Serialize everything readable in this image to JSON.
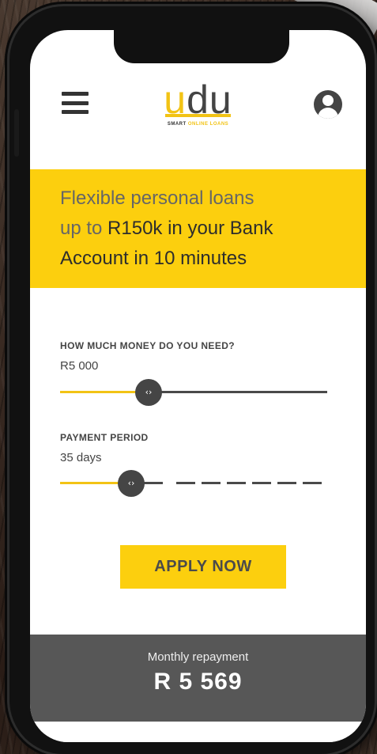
{
  "app": {
    "logo_text_u": "u",
    "logo_text_rest": "du",
    "tagline_part1": "SMART ",
    "tagline_part2": "ONLINE LOANS"
  },
  "banner": {
    "line1": "Flexible personal loans",
    "line2_light": "up to ",
    "line2_strong": "R150k in your Bank",
    "line3": "Account in 10 minutes"
  },
  "loan_amount": {
    "label": "HOW MUCH MONEY DO YOU NEED?",
    "value": "R5 000",
    "knob_glyph": "‹›"
  },
  "payment_period": {
    "label": "PAYMENT PERIOD",
    "value": "35 days",
    "knob_glyph": "‹›"
  },
  "cta": {
    "apply_label": "APPLY NOW"
  },
  "summary": {
    "label": "Monthly repayment",
    "amount": "R 5 569"
  },
  "icons": {
    "menu": "hamburger-menu-icon",
    "profile": "user-avatar-icon"
  },
  "colors": {
    "accent": "#fccf0e",
    "dark": "#575757",
    "text": "#444444"
  }
}
